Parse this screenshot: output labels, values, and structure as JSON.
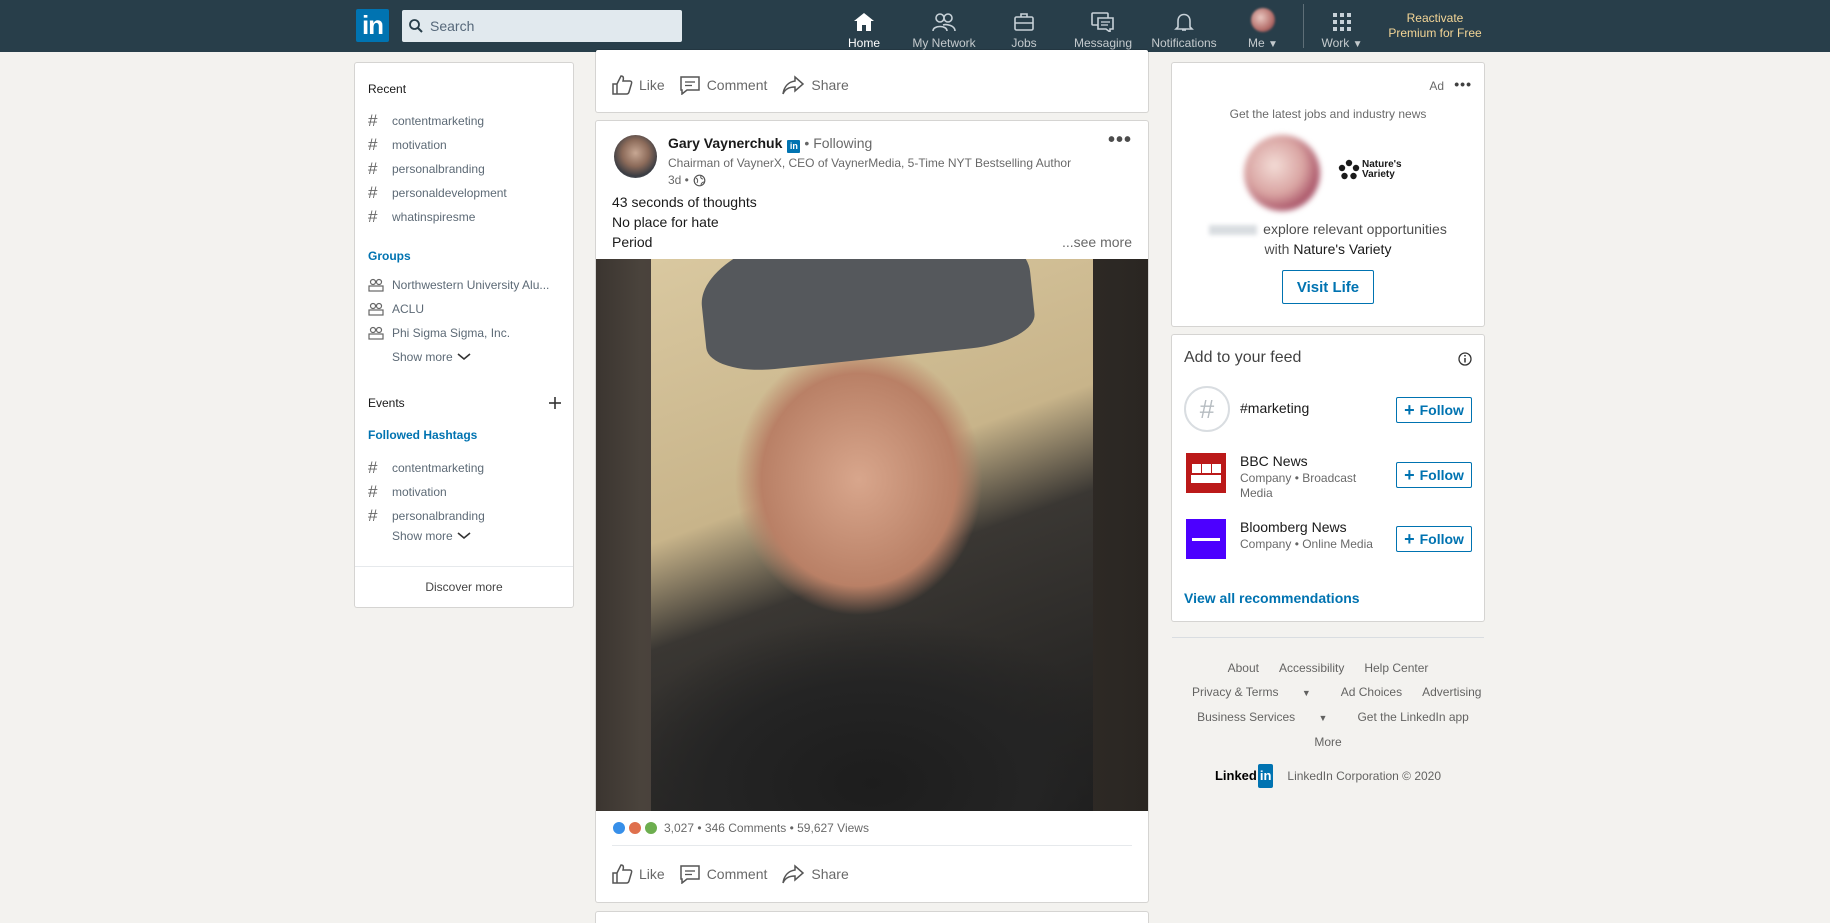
{
  "nav": {
    "search_placeholder": "Search",
    "items": [
      {
        "label": "Home"
      },
      {
        "label": "My Network"
      },
      {
        "label": "Jobs"
      },
      {
        "label": "Messaging"
      },
      {
        "label": "Notifications"
      },
      {
        "label": "Me"
      },
      {
        "label": "Work"
      }
    ],
    "premium_line1": "Reactivate",
    "premium_line2": "Premium for Free"
  },
  "left": {
    "recent_title": "Recent",
    "recent": [
      "contentmarketing",
      "motivation",
      "personalbranding",
      "personaldevelopment",
      "whatinspiresme"
    ],
    "groups_title": "Groups",
    "groups": [
      "Northwestern University Alu...",
      "ACLU",
      "Phi Sigma Sigma, Inc."
    ],
    "show_more": "Show more",
    "events_title": "Events",
    "hashtags_title": "Followed Hashtags",
    "hashtags": [
      "contentmarketing",
      "motivation",
      "personalbranding"
    ],
    "discover": "Discover more"
  },
  "feed": {
    "actions": {
      "like": "Like",
      "comment": "Comment",
      "share": "Share"
    },
    "post": {
      "author": "Gary Vaynerchuk",
      "following": "• Following",
      "headline": "Chairman of VaynerX, CEO of VaynerMedia, 5-Time NYT Bestselling Author",
      "time": "3d •",
      "lines": [
        "43 seconds of thoughts",
        "No place for hate",
        "Period"
      ],
      "see_more": "...see more",
      "social_counts": "3,027 • 346 Comments • 59,627 Views"
    }
  },
  "right": {
    "ad": {
      "label": "Ad",
      "tagline": "Get the latest jobs and industry news",
      "brand": "Nature's Variety",
      "body_pre": "explore relevant opportunities",
      "body_with": "with",
      "body_brand": "Nature's Variety",
      "cta": "Visit Life"
    },
    "feed": {
      "title": "Add to your feed",
      "items": [
        {
          "name": "#marketing",
          "sub": ""
        },
        {
          "name": "BBC News",
          "sub": "Company • Broadcast Media"
        },
        {
          "name": "Bloomberg News",
          "sub": "Company • Online Media"
        }
      ],
      "follow": "Follow",
      "view_all": "View all recommendations"
    },
    "footer": {
      "links": [
        "About",
        "Accessibility",
        "Help Center",
        "Privacy & Terms",
        "Ad Choices",
        "Advertising",
        "Business Services",
        "Get the LinkedIn app",
        "More"
      ],
      "copyright": "LinkedIn Corporation © 2020"
    }
  },
  "colors": {
    "nav_bg": "#283e4a",
    "brand_blue": "#0073b1",
    "premium_gold": "#f3d596"
  }
}
